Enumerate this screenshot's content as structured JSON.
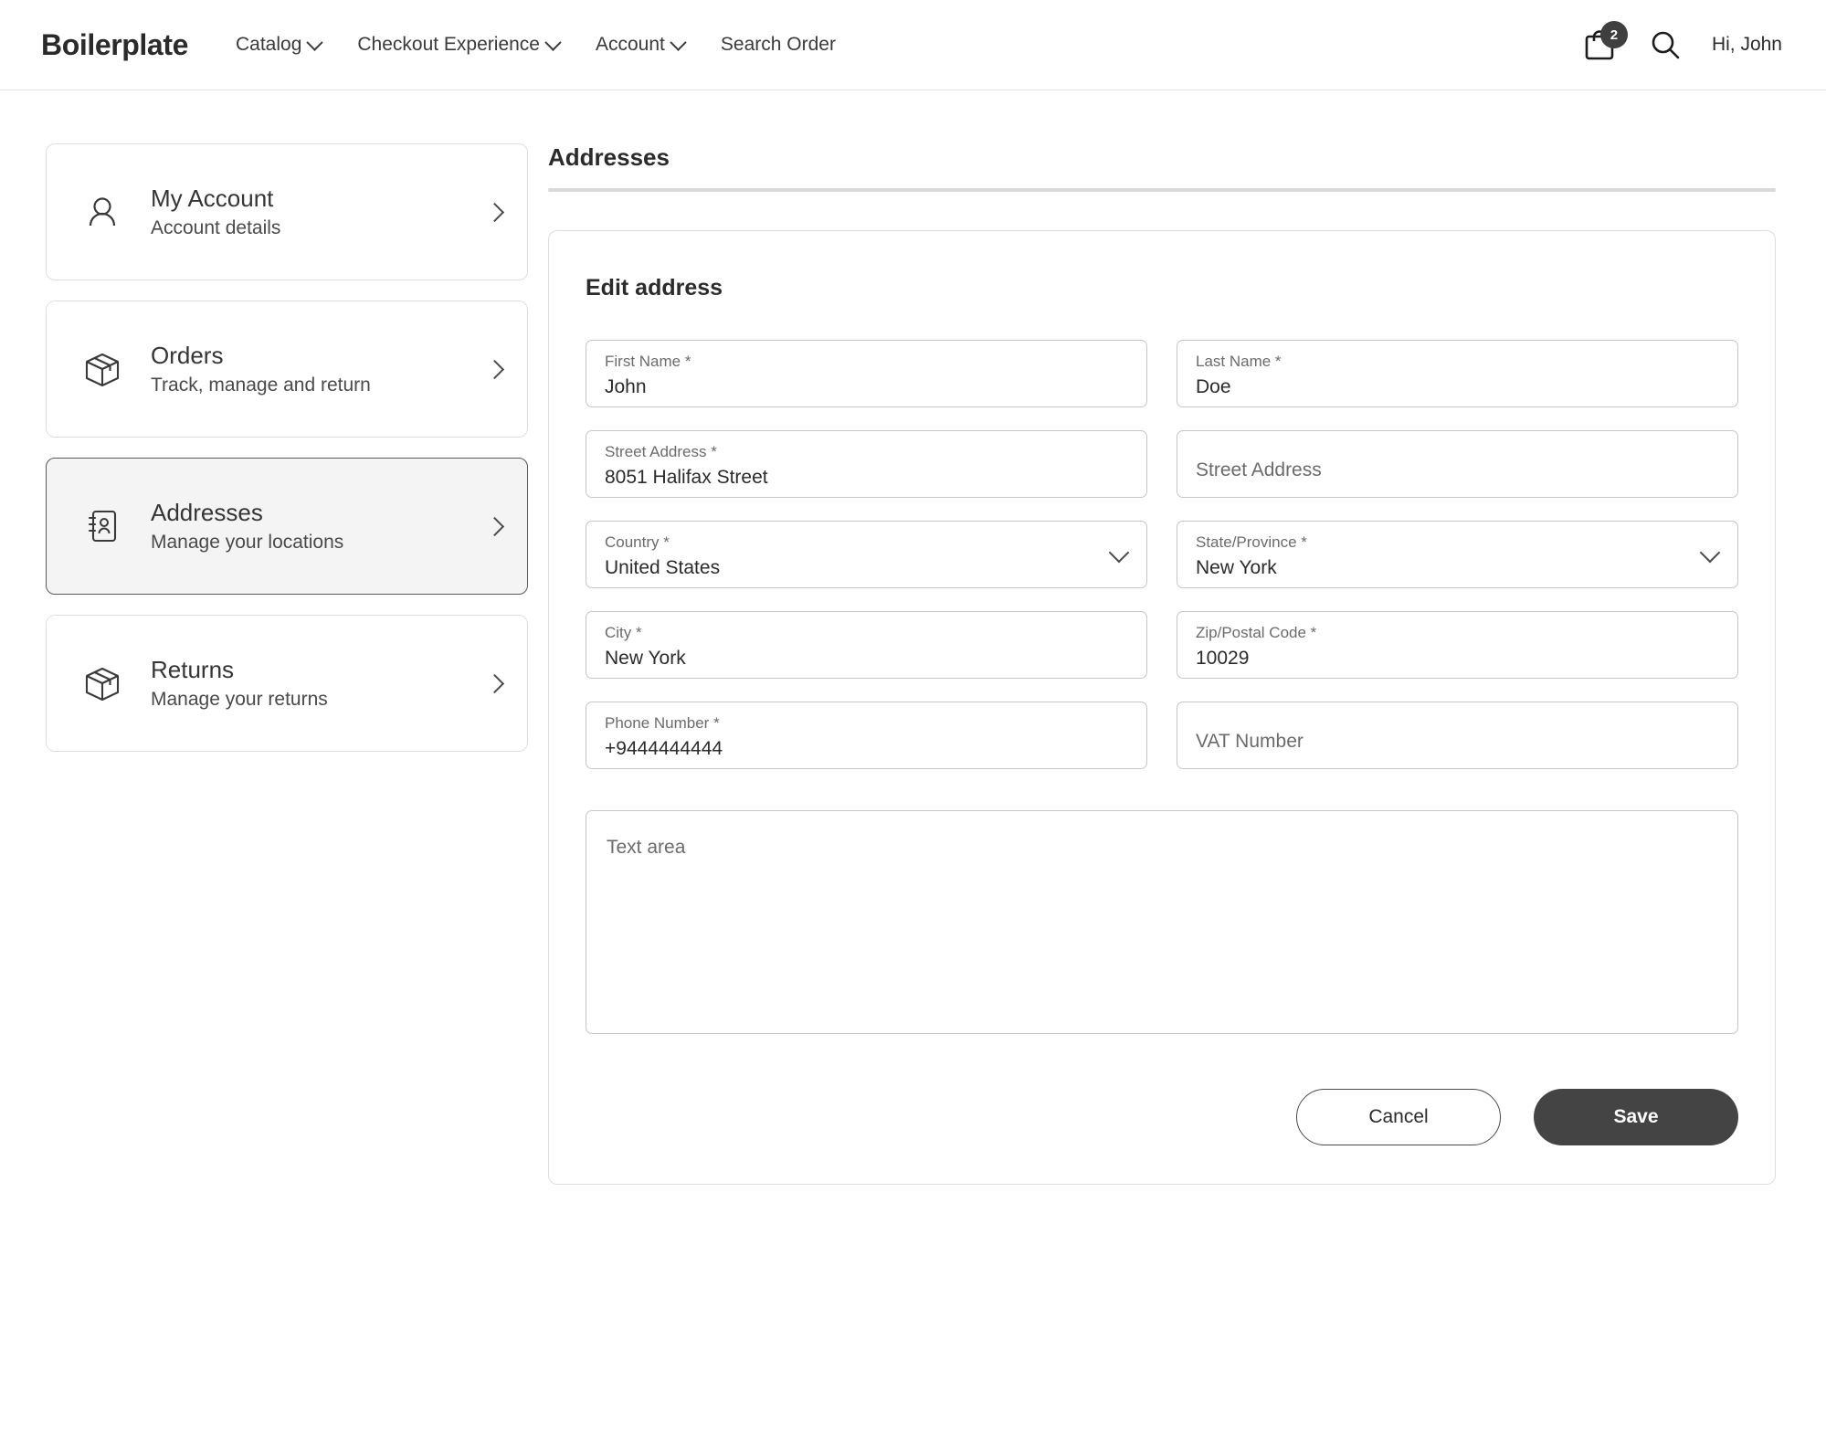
{
  "header": {
    "brand": "Boilerplate",
    "nav": [
      {
        "label": "Catalog",
        "has_chevron": true
      },
      {
        "label": "Checkout Experience",
        "has_chevron": true
      },
      {
        "label": "Account",
        "has_chevron": true
      },
      {
        "label": "Search Order",
        "has_chevron": false
      }
    ],
    "cart_badge_count": "2",
    "cart_icon": "shopping-bag-icon",
    "search_icon": "search-icon",
    "greeting": "Hi, John"
  },
  "sidebar": {
    "items": [
      {
        "title": "My Account",
        "subtitle": "Account details",
        "icon": "person-icon",
        "active": false
      },
      {
        "title": "Orders",
        "subtitle": "Track, manage and return",
        "icon": "package-box-icon",
        "active": false
      },
      {
        "title": "Addresses",
        "subtitle": "Manage your locations",
        "icon": "address-book-icon",
        "active": true
      },
      {
        "title": "Returns",
        "subtitle": "Manage your returns",
        "icon": "package-box-icon",
        "active": false
      }
    ]
  },
  "main": {
    "section_title": "Addresses",
    "panel_title": "Edit address",
    "fields": {
      "first_name": {
        "label": "First Name *",
        "value": "John"
      },
      "last_name": {
        "label": "Last Name *",
        "value": "Doe"
      },
      "street_address_1": {
        "label": "Street Address *",
        "value": "8051 Halifax Street"
      },
      "street_address_2": {
        "placeholder": "Street Address",
        "value": ""
      },
      "country": {
        "label": "Country *",
        "value": "United States"
      },
      "state_province": {
        "label": "State/Province *",
        "value": "New York"
      },
      "city": {
        "label": "City *",
        "value": "New York"
      },
      "zip_postal_code": {
        "label": "Zip/Postal Code *",
        "value": "10029"
      },
      "phone_number": {
        "label": "Phone Number *",
        "value": "+9444444444"
      },
      "vat_number": {
        "placeholder": "VAT Number",
        "value": ""
      },
      "text_area": {
        "placeholder": "Text area",
        "value": ""
      }
    },
    "buttons": {
      "cancel": "Cancel",
      "save": "Save"
    }
  },
  "colors": {
    "save_button_bg": "#444444",
    "active_card_bg": "#f4f4f4",
    "border": "#dedede",
    "badge_bg": "#3f3f3f"
  }
}
